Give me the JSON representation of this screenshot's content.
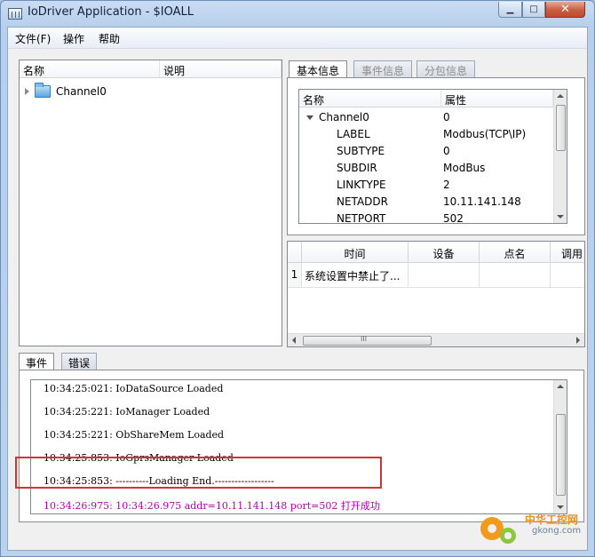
{
  "window": {
    "title": "IoDriver Application - $IOALL",
    "controls": {
      "minimize": "▁",
      "maximize": "□",
      "close": "✕"
    }
  },
  "menu": [
    "文件(F)",
    "操作",
    "帮助"
  ],
  "tree_panel": {
    "columns": [
      "名称",
      "说明"
    ],
    "items": [
      {
        "label": "Channel0",
        "icon": "folder-icon",
        "expanded": false
      }
    ]
  },
  "right_tabs": [
    {
      "label": "基本信息",
      "active": true
    },
    {
      "label": "事件信息",
      "active": false
    },
    {
      "label": "分包信息",
      "active": false
    }
  ],
  "property_grid": {
    "columns": [
      "名称",
      "属性"
    ],
    "rows": [
      {
        "name": "Channel0",
        "value": "0",
        "expandable": true
      },
      {
        "name": "LABEL",
        "value": "Modbus(TCP\\IP)"
      },
      {
        "name": "SUBTYPE",
        "value": "0"
      },
      {
        "name": "SUBDIR",
        "value": "ModBus"
      },
      {
        "name": "LINKTYPE",
        "value": "2"
      },
      {
        "name": "NETADDR",
        "value": "10.11.141.148"
      },
      {
        "name": "NETPORT",
        "value": "502"
      }
    ]
  },
  "event_table": {
    "columns": [
      "时间",
      "设备",
      "点名",
      "调用"
    ],
    "rows": [
      {
        "index": "1",
        "time": "系统设置中禁止了...",
        "device": "",
        "point": "",
        "call": ""
      }
    ],
    "scroll_grip": "III"
  },
  "bottom_tabs": [
    {
      "label": "事件",
      "active": true
    },
    {
      "label": "错误",
      "active": false
    }
  ],
  "log": {
    "lines": [
      "10:34:25:021: IoDataSource Loaded",
      "10:34:25:221: IoManager Loaded",
      "10:34:25:221: ObShareMem Loaded",
      "10:34:25:853: IoGprsManager Loaded",
      "10:34:25:853: ----------Loading End.------------------"
    ],
    "highlight_line": "10:34:26:975: 10:34:26.975 addr=10.11.141.148 port=502 打开成功",
    "highlight_color": "#b300b3"
  },
  "watermark": {
    "brand": "中华工控网",
    "url": "gkong.com"
  },
  "colors": {
    "accent_red": "#d43333",
    "watermark_orange": "#f29a1c"
  }
}
